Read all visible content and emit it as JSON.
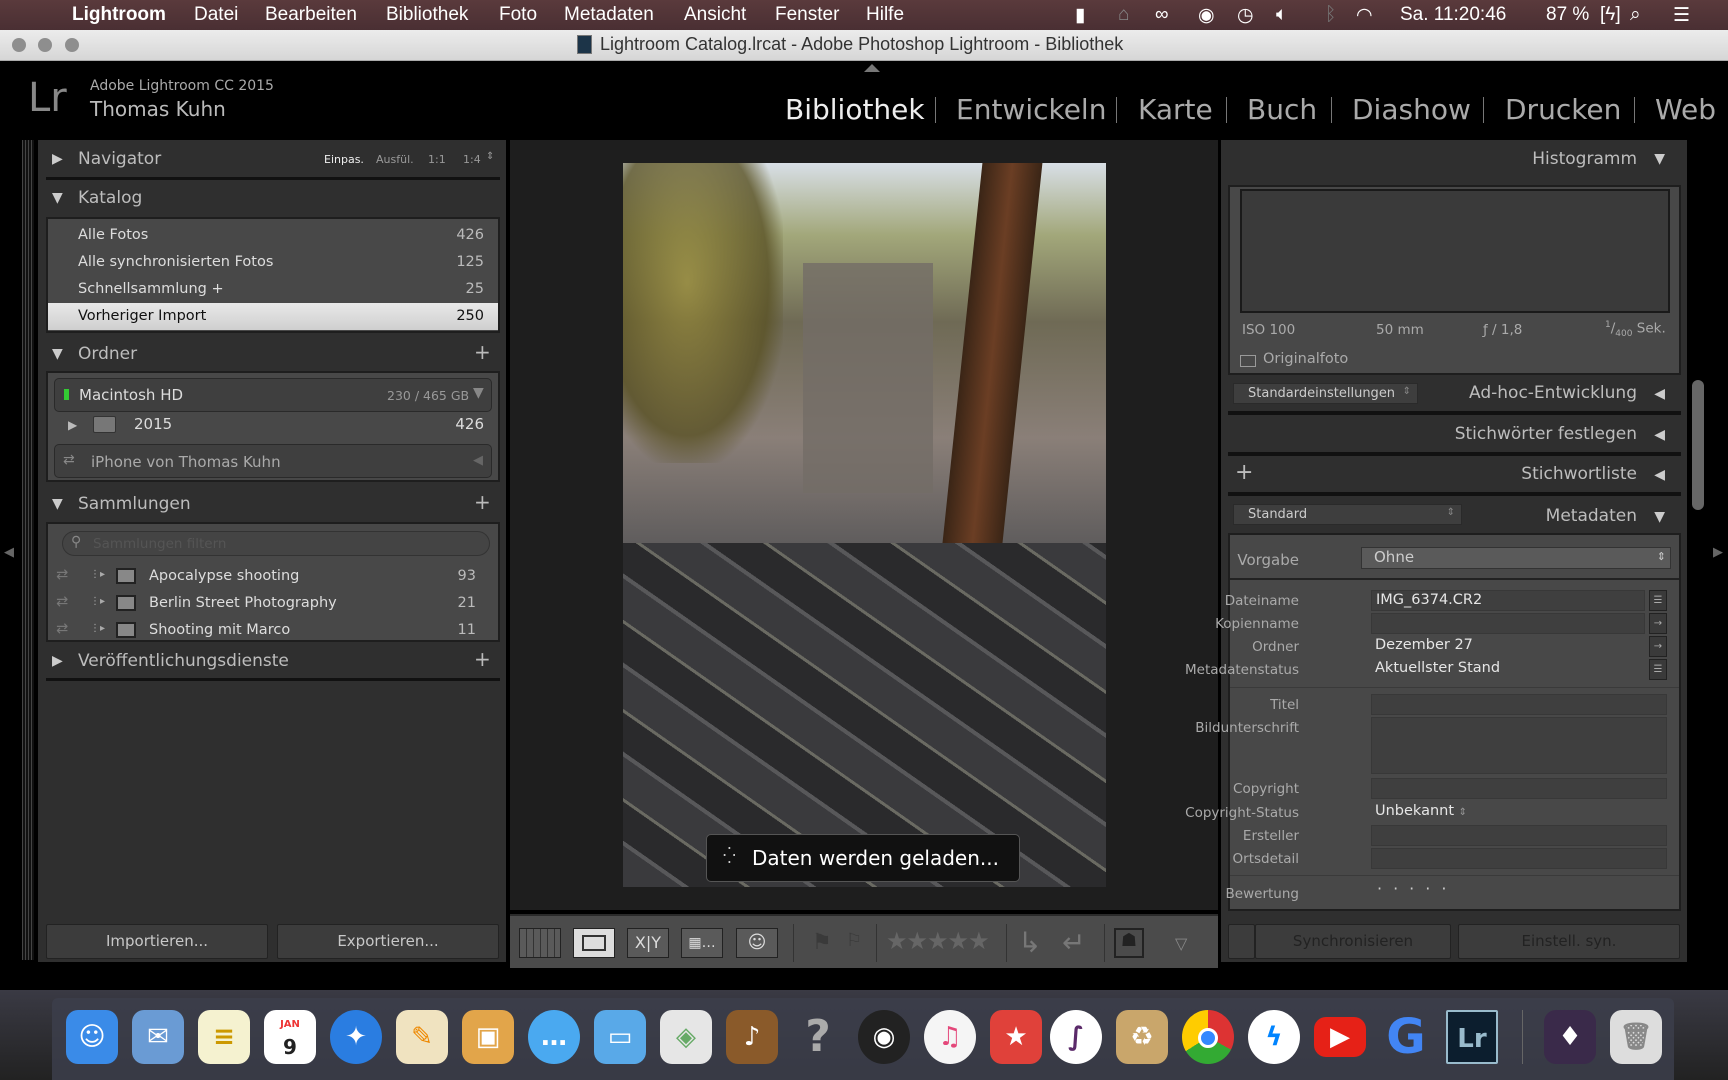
{
  "menubar": {
    "app": "Lightroom",
    "items": [
      "Datei",
      "Bearbeiten",
      "Bibliothek",
      "Foto",
      "Metadaten",
      "Ansicht",
      "Fenster",
      "Hilfe"
    ],
    "clock": "Sa. 11:20:46",
    "battery": "87 %"
  },
  "window": {
    "title": "Lightroom Catalog.lrcat - Adobe Photoshop Lightroom - Bibliothek"
  },
  "identity": {
    "logo": "Lr",
    "product": "Adobe Lightroom CC 2015",
    "user": "Thomas Kuhn"
  },
  "modules": [
    "Bibliothek",
    "Entwickeln",
    "Karte",
    "Buch",
    "Diashow",
    "Drucken",
    "Web"
  ],
  "active_module": "Bibliothek",
  "left": {
    "navigator": {
      "title": "Navigator",
      "zoom": [
        "Einpas.",
        "Ausfül.",
        "1:1",
        "1:4"
      ]
    },
    "catalog": {
      "title": "Katalog",
      "items": [
        {
          "label": "Alle Fotos",
          "count": "426"
        },
        {
          "label": "Alle synchronisierten Fotos",
          "count": "125"
        },
        {
          "label": "Schnellsammlung +",
          "count": "25"
        },
        {
          "label": "Vorheriger Import",
          "count": "250"
        }
      ]
    },
    "folders": {
      "title": "Ordner",
      "volume": "Macintosh HD",
      "volume_size": "230 / 465 GB",
      "folder": "2015",
      "folder_count": "426",
      "device": "iPhone von Thomas Kuhn"
    },
    "collections": {
      "title": "Sammlungen",
      "filter_placeholder": "Sammlungen filtern",
      "items": [
        {
          "label": "Apocalypse shooting",
          "count": "93"
        },
        {
          "label": "Berlin Street Photography",
          "count": "21"
        },
        {
          "label": "Shooting mit Marco",
          "count": "11"
        }
      ]
    },
    "publish": {
      "title": "Veröffentlichungsdienste"
    },
    "import_label": "Importieren...",
    "export_label": "Exportieren..."
  },
  "center": {
    "loading": "Daten werden geladen...",
    "toolbar": {
      "rating_stars": 0,
      "compare_x": "X",
      "compare_y": "Y"
    }
  },
  "right": {
    "histogram": {
      "title": "Histogramm",
      "iso": "ISO 100",
      "focal": "50 mm",
      "aperture": "ƒ / 1,8",
      "shutter_num": "1",
      "shutter_den": "400",
      "shutter_unit": "Sek.",
      "original": "Originalfoto"
    },
    "quick_develop": {
      "title": "Ad-hoc-Entwicklung",
      "preset": "Standardeinstellungen"
    },
    "keywording": {
      "title": "Stichwörter festlegen"
    },
    "keyword_list": {
      "title": "Stichwortliste"
    },
    "metadata": {
      "title": "Metadaten",
      "view": "Standard",
      "preset_label": "Vorgabe",
      "preset": "Ohne",
      "fields": {
        "dateiname_l": "Dateiname",
        "dateiname": "IMG_6374.CR2",
        "kopienname_l": "Kopienname",
        "ordner_l": "Ordner",
        "ordner": "Dezember 27",
        "status_l": "Metadatenstatus",
        "status": "Aktuellster Stand",
        "titel_l": "Titel",
        "bildunterschrift_l": "Bildunterschrift",
        "copyright_l": "Copyright",
        "cstatus_l": "Copyright-Status",
        "cstatus": "Unbekannt",
        "ersteller_l": "Ersteller",
        "ortsdetail_l": "Ortsdetail",
        "bewertung_l": "Bewertung"
      }
    },
    "sync_label": "Synchronisieren",
    "sync_settings_label": "Einstell. syn."
  },
  "dock": {
    "calendar_month": "JAN",
    "calendar_day": "9",
    "lr": "Lr"
  }
}
